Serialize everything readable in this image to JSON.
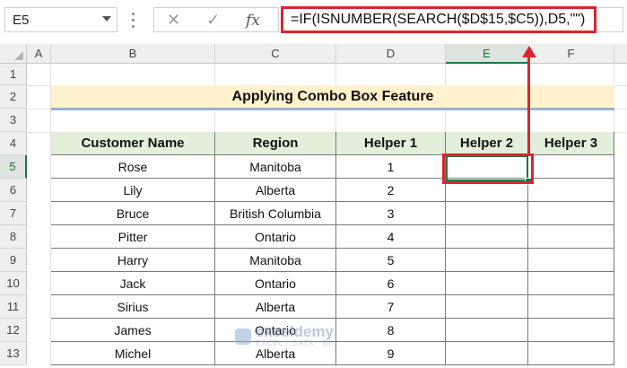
{
  "name_box": {
    "value": "E5"
  },
  "formula_bar": {
    "formula": "=IF(ISNUMBER(SEARCH($D$15,$C5)),D5,\"\")",
    "cancel_icon": "cancel-icon",
    "enter_icon": "check-icon",
    "fx_label": "fx"
  },
  "columns": [
    "A",
    "B",
    "C",
    "D",
    "E",
    "F"
  ],
  "rows": [
    "1",
    "2",
    "3",
    "4",
    "5",
    "6",
    "7",
    "8",
    "9",
    "10",
    "11",
    "12",
    "13"
  ],
  "title": "Applying Combo Box Feature",
  "table": {
    "headers": [
      "Customer Name",
      "Region",
      "Helper 1",
      "Helper 2",
      "Helper 3"
    ],
    "rows": [
      [
        "Rose",
        "Manitoba",
        "1",
        "",
        ""
      ],
      [
        "Lily",
        "Alberta",
        "2",
        "",
        ""
      ],
      [
        "Bruce",
        "British Columbia",
        "3",
        "",
        ""
      ],
      [
        "Pitter",
        "Ontario",
        "4",
        "",
        ""
      ],
      [
        "Harry",
        "Manitoba",
        "5",
        "",
        ""
      ],
      [
        "Jack",
        "Ontario",
        "6",
        "",
        ""
      ],
      [
        "Sirius",
        "Alberta",
        "7",
        "",
        ""
      ],
      [
        "James",
        "Ontario",
        "8",
        "",
        ""
      ],
      [
        "Michel",
        "Alberta",
        "9",
        "",
        ""
      ]
    ]
  },
  "watermark": {
    "name": "exceldemy",
    "tagline": "EXCEL · DATA · BI"
  },
  "colors": {
    "accent_green": "#217346",
    "highlight_red": "#d9262e",
    "header_fill": "#e2efda",
    "title_fill": "#fff2cc"
  }
}
